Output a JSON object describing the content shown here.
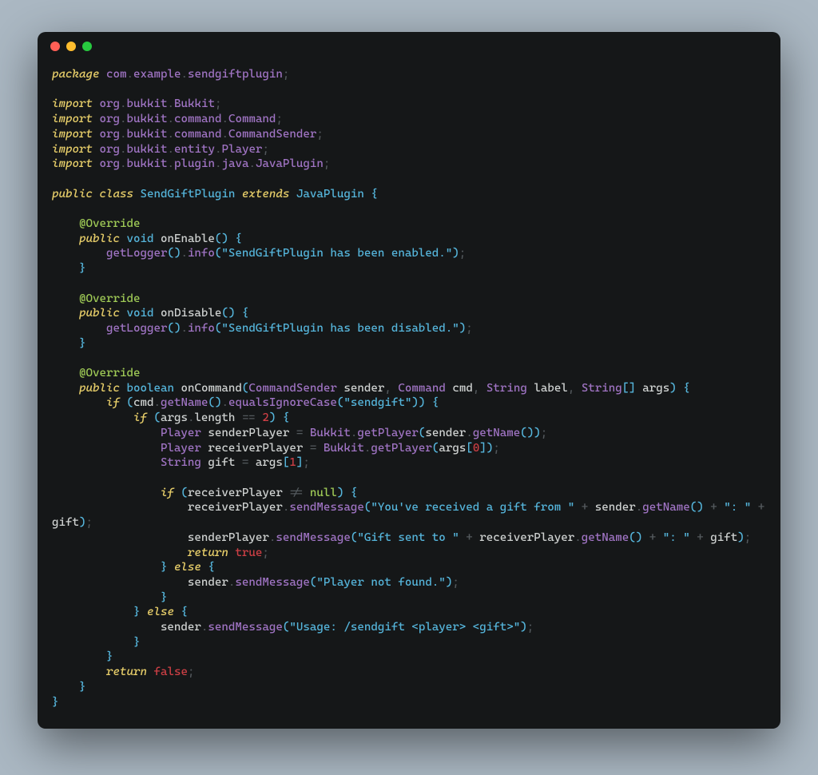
{
  "tokens": {
    "kw_package": "package",
    "kw_import": "import",
    "kw_public": "public",
    "kw_class": "class",
    "kw_extends": "extends",
    "kw_if": "if",
    "kw_else": "else",
    "kw_return": "return",
    "void": "void",
    "boolean": "boolean",
    "ann_override": "@Override",
    "null": "null",
    "true": "true",
    "false": "false",
    "n2": "2",
    "n0": "0",
    "n1": "1",
    "cls_SendGiftPlugin": "SendGiftPlugin",
    "cls_JavaPlugin": "JavaPlugin",
    "m_onEnable": "onEnable",
    "m_onDisable": "onDisable",
    "m_onCommand": "onCommand",
    "fn_getLogger": "getLogger",
    "fn_info": "info",
    "fn_getName": "getName",
    "fn_equalsIgnoreCase": "equalsIgnoreCase",
    "fn_getPlayer": "getPlayer",
    "fn_sendMessage": "sendMessage",
    "t_CommandSender": "CommandSender",
    "t_Command": "Command",
    "t_String": "String",
    "t_Player": "Player",
    "t_Bukkit": "Bukkit",
    "v_sender": "sender",
    "v_cmd": "cmd",
    "v_label": "label",
    "v_args": "args",
    "v_senderPlayer": "senderPlayer",
    "v_receiverPlayer": "receiverPlayer",
    "v_gift": "gift",
    "v_length": "length",
    "s_enabled": "\"SendGiftPlugin has been enabled.\"",
    "s_disabled": "\"SendGiftPlugin has been disabled.\"",
    "s_sendgift": "\"sendgift\"",
    "s_recv": "\"You've received a gift from \"",
    "s_colon": "\": \"",
    "s_sent": "\"Gift sent to \"",
    "s_notfound": "\"Player not found.\"",
    "s_usage": "\"Usage: /sendgift <player> <gift>\"",
    "pkg_com": "com",
    "pkg_example": "example",
    "pkg_sendgiftplugin": "sendgiftplugin",
    "pkg_org": "org",
    "pkg_bukkit": "bukkit",
    "pkg_Bukkit": "Bukkit",
    "pkg_command": "command",
    "pkg_Command": "Command",
    "pkg_CommandSender": "CommandSender",
    "pkg_entity": "entity",
    "pkg_Player": "Player",
    "pkg_plugin": "plugin",
    "pkg_java": "java",
    "pkg_JavaPlugin": "JavaPlugin"
  }
}
